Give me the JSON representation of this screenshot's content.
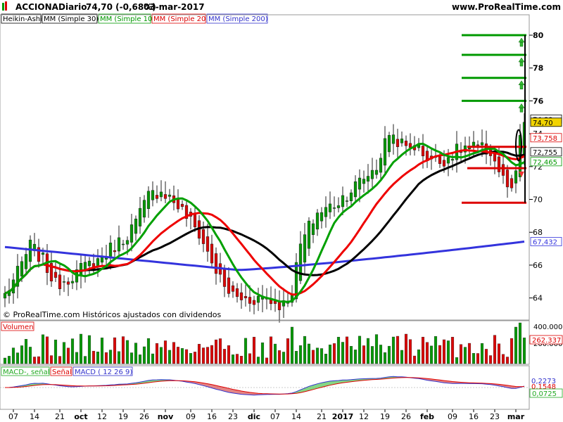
{
  "header": {
    "symbol": "ACCIONA",
    "period": "Diario",
    "last_change": "74,70 (-0,68%)",
    "date": "03-mar-2017",
    "site": "www.ProRealTime.com"
  },
  "legend": {
    "items": [
      {
        "label": "Heikin-Ashi",
        "color": "#000000"
      },
      {
        "label": "MM (Simple 30)",
        "color": "#000000"
      },
      {
        "label": "MM (Simple 10)",
        "color": "#009900"
      },
      {
        "label": "MM (Simple 20)",
        "color": "#dd0000"
      },
      {
        "label": "MM (Simple 200)",
        "color": "#3333cc"
      }
    ]
  },
  "footer_note": "© ProRealTime.com Históricos ajustados con dividendos",
  "volume_panel": {
    "label": "Volumen",
    "ticks": [
      "400.000",
      "200.000"
    ],
    "last_value": "262.337"
  },
  "macd_panel": {
    "labels": [
      "MACD-, señal",
      "Señal",
      "MACD ( 12 26 9)"
    ],
    "values": [
      "0,2273",
      "0,1548",
      "0,0725"
    ]
  },
  "price_labels": {
    "upper": "74,89",
    "close": "74,70",
    "sma20": "73,758",
    "sma30": "72,755",
    "sma10": "72,465",
    "sma200": "67,432"
  },
  "colors": {
    "up": "#009900",
    "down": "#dd0000",
    "sma30": "#000000",
    "sma10": "#00a000",
    "sma20": "#ee0000",
    "sma200": "#3333dd",
    "arrow_up": "#33bb33",
    "arrow_down": "#ee3333"
  },
  "chart_data": {
    "type": "candlestick",
    "title": "ACCIONA Diario",
    "y_axis": {
      "ticks": [
        64,
        66,
        68,
        70,
        72,
        74,
        76,
        78,
        80
      ],
      "range": [
        62.7,
        81.2
      ]
    },
    "x_axis": {
      "tick_labels": [
        "07",
        "14",
        "21",
        "oct",
        "12",
        "19",
        "26",
        "nov",
        "09",
        "16",
        "23",
        "dic",
        "07",
        "14",
        "21",
        "2017",
        "12",
        "19",
        "26",
        "feb",
        "09",
        "16",
        "23",
        "mar"
      ]
    },
    "sessions": 124,
    "price_anchors": [
      [
        0,
        64.2
      ],
      [
        3,
        65.5
      ],
      [
        6,
        67.2
      ],
      [
        9,
        66.3
      ],
      [
        12,
        64.8
      ],
      [
        16,
        65.4
      ],
      [
        19,
        65.9
      ],
      [
        22,
        66.3
      ],
      [
        25,
        67.0
      ],
      [
        28,
        67.6
      ],
      [
        31,
        68.6
      ],
      [
        34,
        70.2
      ],
      [
        37,
        70.6
      ],
      [
        40,
        69.9
      ],
      [
        43,
        69.0
      ],
      [
        46,
        67.9
      ],
      [
        49,
        66.2
      ],
      [
        52,
        64.6
      ],
      [
        55,
        64.0
      ],
      [
        58,
        63.9
      ],
      [
        61,
        64.1
      ],
      [
        64,
        63.7
      ],
      [
        66,
        63.6
      ],
      [
        68,
        64.5
      ],
      [
        70,
        67.2
      ],
      [
        72,
        68.3
      ],
      [
        74,
        69.2
      ],
      [
        76,
        69.4
      ],
      [
        79,
        69.9
      ],
      [
        82,
        70.6
      ],
      [
        85,
        71.3
      ],
      [
        88,
        72.0
      ],
      [
        91,
        74.1
      ],
      [
        93,
        73.6
      ],
      [
        95,
        73.1
      ],
      [
        97,
        73.3
      ],
      [
        100,
        72.6
      ],
      [
        103,
        72.3
      ],
      [
        106,
        72.8
      ],
      [
        109,
        73.2
      ],
      [
        112,
        73.1
      ],
      [
        115,
        72.9
      ],
      [
        118,
        71.2
      ],
      [
        120,
        70.3
      ],
      [
        121,
        71.5
      ],
      [
        122,
        73.9
      ],
      [
        123,
        74.7
      ]
    ],
    "resistance_levels": [
      80.0,
      78.8,
      77.4,
      76.0
    ],
    "support_levels": [
      73.2,
      71.9,
      69.8
    ],
    "last_close": 74.7,
    "series": [
      {
        "name": "MM (Simple 30)",
        "values": "computed from closes"
      },
      {
        "name": "MM (Simple 10)",
        "values": "computed from closes"
      },
      {
        "name": "MM (Simple 20)",
        "values": "computed from closes"
      },
      {
        "name": "MM (Simple 200)",
        "start": 67.1,
        "mid": 65.7,
        "end": 67.43
      }
    ]
  }
}
